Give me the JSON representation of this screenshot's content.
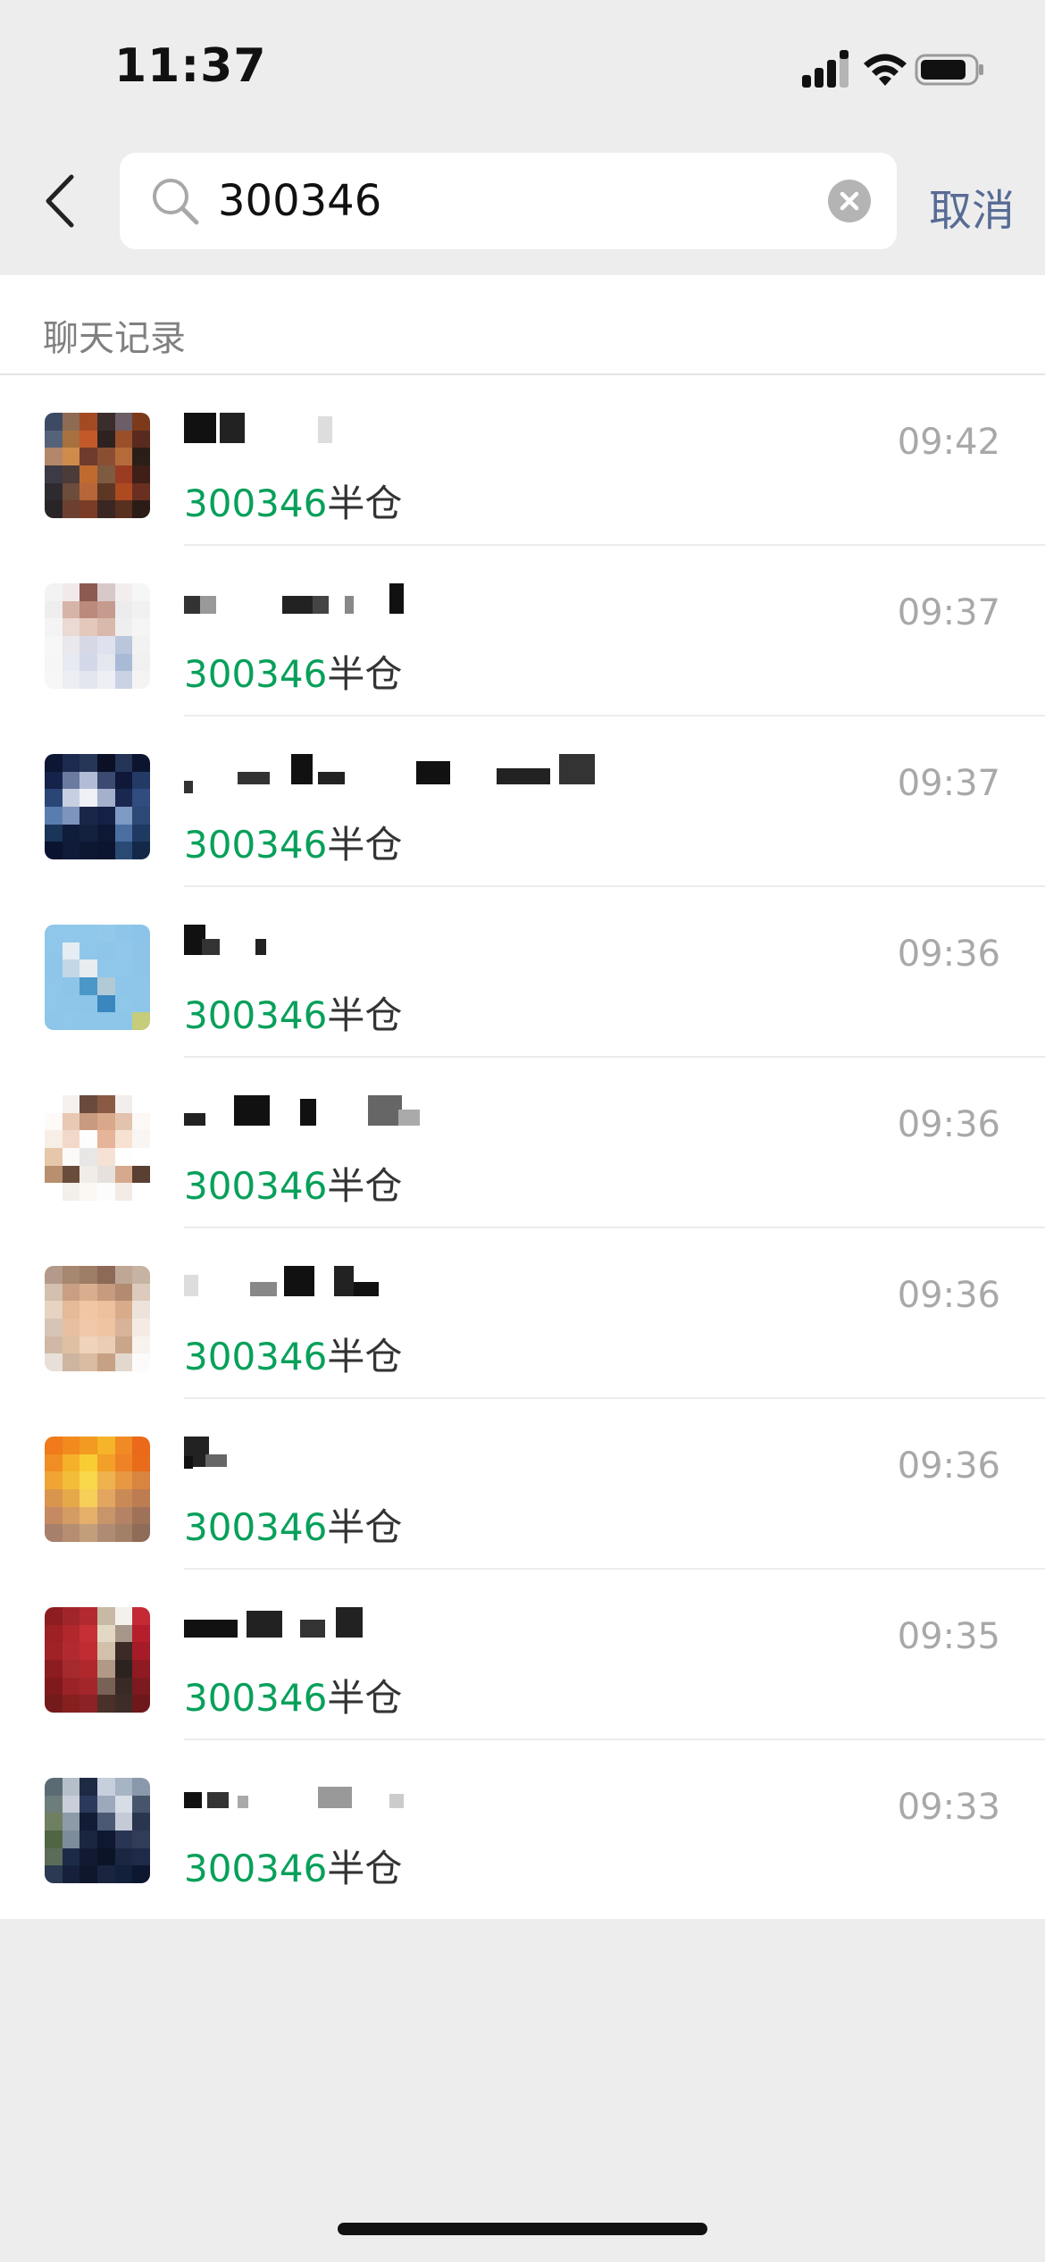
{
  "status_bar": {
    "time": "11:37",
    "icons": [
      "signal-icon",
      "wifi-icon",
      "battery-icon"
    ]
  },
  "search": {
    "query": "300346",
    "cancel_label": "取消"
  },
  "section": {
    "title": "聊天记录"
  },
  "results": [
    {
      "time": "09:42",
      "match": "300346",
      "rest": "半仓",
      "avatar_colors": [
        "#3c4a63",
        "#8e6b52",
        "#a44a22",
        "#3a2d2c",
        "#6b5e66",
        "#7c3a1a",
        "#54627a",
        "#a8703f",
        "#c3592a",
        "#2d2220",
        "#9a4f2a",
        "#5a2a1e",
        "#b2876a",
        "#d08b4c",
        "#6e3b2c",
        "#8a4f33",
        "#b56a3a",
        "#2b1e19",
        "#3c3a44",
        "#4b3b39",
        "#c06a30",
        "#7e5a40",
        "#9b3c22",
        "#401f16",
        "#2d2b2f",
        "#6c4c3b",
        "#b66638",
        "#5d3624",
        "#ad4a20",
        "#6a2f20",
        "#292527",
        "#6b4030",
        "#7a3c26",
        "#3a2622",
        "#58301f",
        "#2c1c18"
      ]
    },
    {
      "time": "09:37",
      "match": "300346",
      "rest": "半仓",
      "avatar_colors": [
        "#f4f3f3",
        "#f2eaea",
        "#8c5a50",
        "#d7c9c9",
        "#f3eeee",
        "#f6f6f6",
        "#eeeeee",
        "#d7b4a8",
        "#bc8a7c",
        "#c59b8e",
        "#ececec",
        "#f1f1f1",
        "#f4f4f4",
        "#ebd9d3",
        "#e4c8bc",
        "#d8b9ab",
        "#eeeeee",
        "#f5f5f5",
        "#f7f7f7",
        "#e9e9ed",
        "#d6d8e6",
        "#dfe2ee",
        "#b9c6dc",
        "#f2f2f2",
        "#f6f6f6",
        "#e8eaf2",
        "#d3d8e9",
        "#e5e7ef",
        "#a8bad6",
        "#f0f0f0",
        "#f7f7f7",
        "#eceef3",
        "#e3e6ee",
        "#eeeff4",
        "#c9d3e4",
        "#f4f4f4"
      ]
    },
    {
      "time": "09:37",
      "match": "300346",
      "rest": "半仓",
      "avatar_colors": [
        "#0d1633",
        "#1b2a4e",
        "#263657",
        "#0b1027",
        "#233456",
        "#0c1530",
        "#15224a",
        "#6a7aa0",
        "#b3bcd6",
        "#3a4a70",
        "#0f1838",
        "#243a66",
        "#2a4676",
        "#c7cfe2",
        "#eef0f6",
        "#a4b0cc",
        "#1a2850",
        "#304c80",
        "#5a7db0",
        "#7d94bd",
        "#1a2648",
        "#142047",
        "#7e99c3",
        "#2b4876",
        "#1b3459",
        "#0f1c3a",
        "#13213f",
        "#0d1835",
        "#4b6ea0",
        "#1f3a62",
        "#0a1430",
        "#0f1b38",
        "#0e1732",
        "#0b152f",
        "#2a4a74",
        "#14284a"
      ]
    },
    {
      "time": "09:36",
      "match": "300346",
      "rest": "半仓",
      "avatar_colors": [
        "#8ec7ea",
        "#90c8eb",
        "#8fc7ea",
        "#92c9eb",
        "#8ec6e9",
        "#8bc4e8",
        "#8ec7ea",
        "#e5edf2",
        "#8fc7ea",
        "#8dc6e9",
        "#90c7ea",
        "#8cc5e8",
        "#8ec6e9",
        "#c3d8e6",
        "#e8edf0",
        "#8fc7ea",
        "#8ec7ea",
        "#8dc5e9",
        "#8ec7e9",
        "#8cc5e8",
        "#4b97c8",
        "#b2c9d6",
        "#8dc6e9",
        "#8ec6e9",
        "#8ec7ea",
        "#8ec6ea",
        "#8cc5e8",
        "#3a87c0",
        "#8fc7e9",
        "#8dc6e9",
        "#8dc6e9",
        "#8ec7ea",
        "#8ec6e9",
        "#8dc6e9",
        "#8ec6e9",
        "#c6cc79"
      ]
    },
    {
      "time": "09:36",
      "match": "300346",
      "rest": "半仓",
      "avatar_colors": [
        "#ffffff",
        "#f6f1ee",
        "#6a4a3c",
        "#8a5b44",
        "#f2eeec",
        "#ffffff",
        "#fdfaf8",
        "#e9c8b4",
        "#c89a80",
        "#d9a88a",
        "#e3c3ad",
        "#fbf8f6",
        "#f7eee6",
        "#f2d8c8",
        "#fdfdfd",
        "#e6b498",
        "#f7e2d2",
        "#f9f5f2",
        "#e6c7aa",
        "#fbfaf9",
        "#e8e7e6",
        "#f6e2d4",
        "#fefefe",
        "#ffffff",
        "#b89070",
        "#6a4c3a",
        "#f1ece7",
        "#e6e1dc",
        "#d6a98c",
        "#5a4033",
        "#ffffff",
        "#f3efe9",
        "#fbf7f2",
        "#fcfcfc",
        "#f3ece6",
        "#ffffff"
      ]
    },
    {
      "time": "09:36",
      "match": "300346",
      "rest": "半仓",
      "avatar_colors": [
        "#b49a8a",
        "#a6876f",
        "#9e7d66",
        "#8c6a57",
        "#bfa795",
        "#c6b3a4",
        "#d3c0af",
        "#c89f82",
        "#d9ae8e",
        "#c69b7e",
        "#b28b70",
        "#dccbbd",
        "#e6d3c2",
        "#e4ba98",
        "#f0c6a4",
        "#eec19e",
        "#d8ac8a",
        "#eee3da",
        "#d6c5b6",
        "#e8c09f",
        "#f1c9a8",
        "#efc4a2",
        "#d9b29a",
        "#f4ece4",
        "#cfb9a6",
        "#dfc0a3",
        "#efd3ba",
        "#eacdb4",
        "#c9a58a",
        "#f8f3ef",
        "#e8e0d8",
        "#cdb5a0",
        "#d9bca2",
        "#c6a183",
        "#e3d8ce",
        "#fcfbfa"
      ]
    },
    {
      "time": "09:36",
      "match": "300346",
      "rest": "半仓",
      "avatar_colors": [
        "#f07a1c",
        "#f28a1e",
        "#f29a21",
        "#f5b42a",
        "#f18a24",
        "#ea6a1a",
        "#f08d23",
        "#f5b12a",
        "#f8cd33",
        "#f2a028",
        "#ef8227",
        "#e96c1b",
        "#f0a434",
        "#f3bd3a",
        "#f9d84a",
        "#eeb34e",
        "#e89841",
        "#d9843f",
        "#d9954e",
        "#e6a94a",
        "#f6cf59",
        "#e3a660",
        "#c98a56",
        "#bd7c52",
        "#c58a62",
        "#d49b62",
        "#e6b06a",
        "#c89469",
        "#b58265",
        "#9f7158",
        "#a7806c",
        "#b58e72",
        "#c29e7b",
        "#b08b74",
        "#a28068",
        "#8f6c58"
      ]
    },
    {
      "time": "09:35",
      "match": "300346",
      "rest": "半仓",
      "avatar_colors": [
        "#8d1d20",
        "#a0252a",
        "#b22a30",
        "#c8b9a4",
        "#f4f1ec",
        "#c42a36",
        "#9c2024",
        "#b0272c",
        "#c62f34",
        "#e3d8c4",
        "#a7978a",
        "#b61e2c",
        "#a02126",
        "#b12a2f",
        "#c02c32",
        "#d1c1ab",
        "#3c2a26",
        "#a51c28",
        "#8c1c1f",
        "#a52a2d",
        "#b0282c",
        "#b29985",
        "#2c2220",
        "#8f1a22",
        "#7f191b",
        "#9a2327",
        "#a3262a",
        "#776255",
        "#3a2a25",
        "#7c1a1f",
        "#741a1c",
        "#86201f",
        "#8c2225",
        "#4a3028",
        "#3d2c28",
        "#6e181c"
      ]
    },
    {
      "time": "09:33",
      "match": "300346",
      "rest": "半仓",
      "avatar_colors": [
        "#5a6b74",
        "#b6bfc9",
        "#1e2a44",
        "#c6cfdc",
        "#a7b4c4",
        "#8a98ab",
        "#6d7d7c",
        "#c9ced8",
        "#2b3a5c",
        "#9ca8bb",
        "#d7dde6",
        "#46556c",
        "#6f7f62",
        "#8d9aa8",
        "#121c34",
        "#4a5874",
        "#c4cad6",
        "#2a3650",
        "#4f6544",
        "#7d8c9a",
        "#1a2540",
        "#0f1830",
        "#283653",
        "#303c58",
        "#5d6c58",
        "#1c2a48",
        "#111a30",
        "#0c1428",
        "#1a2642",
        "#1e2a48",
        "#2b3a52",
        "#16203a",
        "#0f172c",
        "#1a243e",
        "#12203c",
        "#0e1730"
      ]
    }
  ]
}
